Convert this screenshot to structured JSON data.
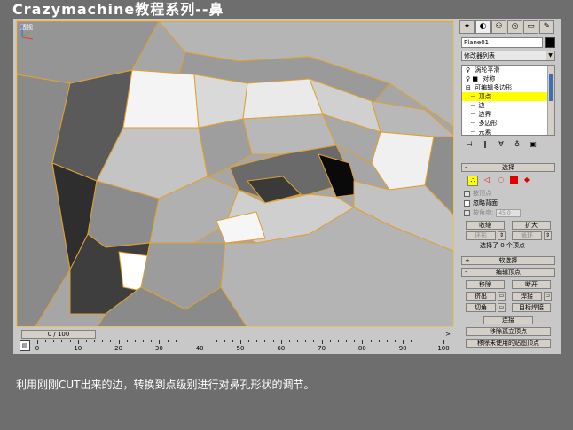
{
  "title": "Crazymachine教程系列--鼻",
  "viewport": {
    "label": "透视"
  },
  "timeline": {
    "frame_display": "0 / 100",
    "arrow": ">",
    "ticks": [
      "0",
      "10",
      "20",
      "30",
      "40",
      "50",
      "60",
      "70",
      "80",
      "90",
      "100"
    ]
  },
  "command_panel": {
    "tabs": [
      {
        "icon": "create-icon",
        "glyph": "✦"
      },
      {
        "icon": "modify-icon",
        "glyph": "◐"
      },
      {
        "icon": "hierarchy-icon",
        "glyph": "⚇"
      },
      {
        "icon": "motion-icon",
        "glyph": "◎"
      },
      {
        "icon": "display-icon",
        "glyph": "▭"
      },
      {
        "icon": "utilities-icon",
        "glyph": "✎"
      }
    ],
    "object_name": "Plane01",
    "object_color": "#000000",
    "modifier_list": "修改器列表",
    "stack": [
      {
        "label": "涡轮平滑",
        "prefix": "♀"
      },
      {
        "label": "对称",
        "prefix": "♀ ■"
      },
      {
        "label": "可编辑多边形",
        "prefix": "⊟"
      },
      {
        "label": "顶点",
        "prefix": "┈"
      },
      {
        "label": "边",
        "prefix": "┈"
      },
      {
        "label": "边界",
        "prefix": "┈"
      },
      {
        "label": "多边形",
        "prefix": "┈"
      },
      {
        "label": "元素",
        "prefix": "┈"
      }
    ],
    "stack_tools": [
      "⊣",
      "‖",
      "∀",
      "♁",
      "▣"
    ],
    "selection": {
      "header": "选择",
      "by_vertex": "按顶点",
      "ignore_backfacing": "忽略背面",
      "by_angle": "按角度:",
      "angle_value": "45.0",
      "shrink": "收缩",
      "grow": "扩大",
      "ring": "环形",
      "loop": "循环",
      "status": "选择了 0 个顶点"
    },
    "soft_selection": {
      "header": "软选择"
    },
    "edit_vertices": {
      "header": "编辑顶点",
      "remove": "移除",
      "break": "断开",
      "extrude": "挤出",
      "weld": "焊接",
      "chamfer": "切角",
      "target_weld": "目标焊接",
      "connect": "连接",
      "remove_isolated": "移除孤立顶点",
      "remove_unused_map": "移除未使用的贴图顶点"
    },
    "colors": {
      "selected_stack": "#ffff00",
      "accent_blue": "#3d6db5",
      "sub_object_red": "#e00000"
    }
  },
  "caption": "利用刚刚CUT出来的边，转换到点级别进行对鼻孔形状的调节。"
}
